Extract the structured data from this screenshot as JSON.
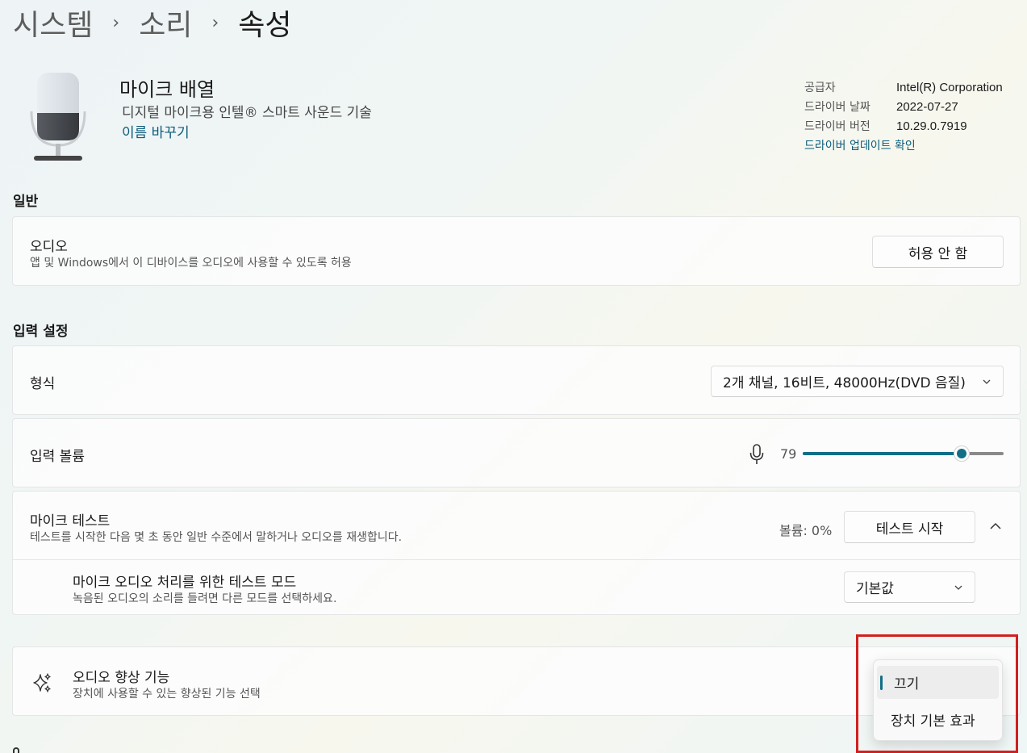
{
  "breadcrumb": {
    "items": [
      "시스템",
      "소리",
      "속성"
    ]
  },
  "device": {
    "name": "마이크 배열",
    "description": "디지털 마이크용 인텔® 스마트 사운드 기술",
    "rename_link": "이름 바꾸기",
    "icon": "microphone-icon"
  },
  "driver_info": {
    "provider_label": "공급자",
    "provider_value": "Intel(R) Corporation",
    "date_label": "드라이버 날짜",
    "date_value": "2022-07-27",
    "version_label": "드라이버 버전",
    "version_value": "10.29.0.7919",
    "update_link": "드라이버 업데이트 확인"
  },
  "general": {
    "title": "일반",
    "audio": {
      "title": "오디오",
      "subtitle": "앱 및 Windows에서 이 디바이스를 오디오에 사용할 수 있도록 허용",
      "button": "허용 안 함"
    }
  },
  "input_settings": {
    "title": "입력 설정",
    "format": {
      "label": "형식",
      "value": "2개 채널, 16비트, 48000Hz(DVD 음질)"
    },
    "volume": {
      "label": "입력 볼륨",
      "value": "79",
      "level": 0.79,
      "icon": "microphone-icon"
    },
    "mic_test": {
      "title": "마이크 테스트",
      "subtitle": "테스트를 시작한 다음 몇 초 동안 일반 수준에서 말하거나 오디오를 재생합니다.",
      "volume_text": "볼륨: 0%",
      "button": "테스트 시작",
      "mode_title": "마이크 오디오 처리를 위한 테스트 모드",
      "mode_subtitle": "녹음된 오디오의 소리를 들려면 다른 모드를 선택하세요.",
      "mode_value": "기본값"
    }
  },
  "enhancements": {
    "title": "오디오 향상 기능",
    "subtitle": "장치에 사용할 수 있는 향상된 기능 선택",
    "icon": "sparkle-icon",
    "menu": {
      "options": [
        "끄기",
        "장치 기본 효과"
      ],
      "selected": "끄기"
    }
  },
  "colors": {
    "accent": "#126e87",
    "link": "#0b5c7c",
    "highlight_box": "#d21f1f"
  }
}
